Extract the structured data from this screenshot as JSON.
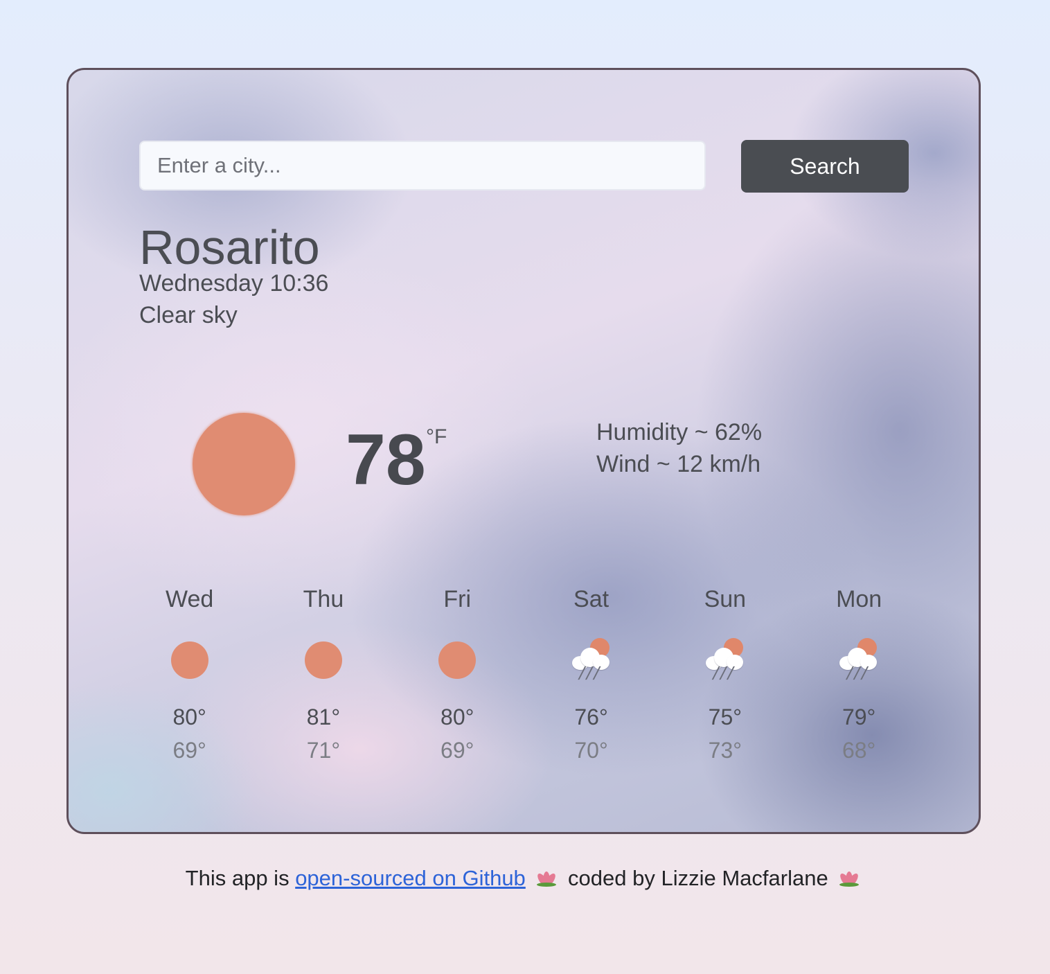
{
  "search": {
    "placeholder": "Enter a city...",
    "button_label": "Search"
  },
  "current": {
    "city": "Rosarito",
    "datetime": "Wednesday 10:36",
    "description": "Clear sky",
    "icon": "sun-icon",
    "temperature": "78",
    "unit": "°F",
    "humidity": "Humidity ~ 62%",
    "wind": "Wind ~ 12 km/h"
  },
  "forecast": [
    {
      "day": "Wed",
      "icon": "sun-icon",
      "max": "80°",
      "min": "69°"
    },
    {
      "day": "Thu",
      "icon": "sun-icon",
      "max": "81°",
      "min": "71°"
    },
    {
      "day": "Fri",
      "icon": "sun-icon",
      "max": "80°",
      "min": "69°"
    },
    {
      "day": "Sat",
      "icon": "sun-behind-rain-cloud-icon",
      "max": "76°",
      "min": "70°"
    },
    {
      "day": "Sun",
      "icon": "sun-behind-rain-cloud-icon",
      "max": "75°",
      "min": "73°"
    },
    {
      "day": "Mon",
      "icon": "sun-behind-rain-cloud-icon",
      "max": "79°",
      "min": "68°"
    }
  ],
  "footer": {
    "prefix": "This app is ",
    "link_text": "open-sourced on Github",
    "middle": " coded by Lizzie Macfarlane ",
    "decoration_icon": "lotus-icon"
  },
  "colors": {
    "sun": "#e08c72",
    "button": "#4a4d52",
    "link": "#2d63d8",
    "card_border": "#5e4f5b"
  }
}
